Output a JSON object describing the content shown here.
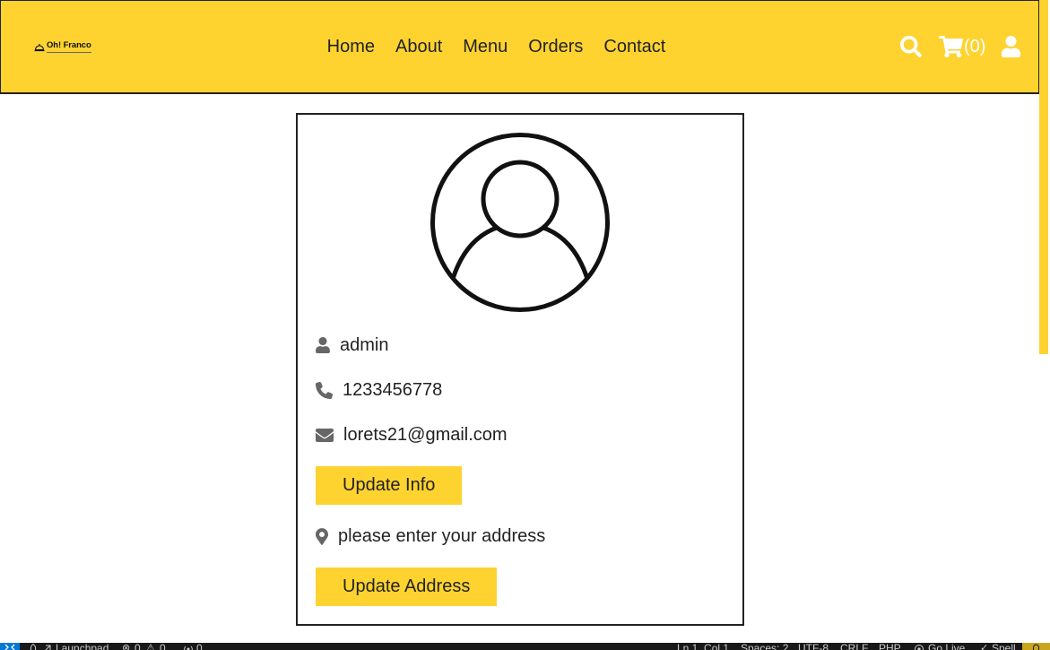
{
  "theme": {
    "accent": "#FED330",
    "text": "#222222",
    "icon_gray": "#666666",
    "header_icon": "#FFFFFF"
  },
  "header": {
    "logo": {
      "text": "Oh! Franco",
      "icon": "dish-logo-icon"
    },
    "nav": [
      {
        "label": "Home"
      },
      {
        "label": "About"
      },
      {
        "label": "Menu"
      },
      {
        "label": "Orders"
      },
      {
        "label": "Contact"
      }
    ],
    "icons": {
      "search": "search-icon",
      "cart": "cart-icon",
      "user": "user-icon"
    },
    "cart_count": "(0)"
  },
  "profile": {
    "avatar_icon": "user-circle-icon",
    "name": {
      "icon": "user-icon",
      "value": "admin"
    },
    "phone": {
      "icon": "phone-icon",
      "value": "1233456778"
    },
    "email": {
      "icon": "envelope-icon",
      "value": "lorets21@gmail.com"
    },
    "update_info_button": "Update Info",
    "address": {
      "icon": "map-marker-icon",
      "value": "please enter your address"
    },
    "update_address_button": "Update Address"
  },
  "status_bar": {
    "left": {
      "remote_icon": "remote-icon",
      "launchpad_icon": "rocket-icon",
      "launchpad": "Launchpad",
      "errors": "0",
      "warnings": "0",
      "ports": "0"
    },
    "right": {
      "position": "Ln 1, Col 1",
      "indentation": "Spaces: 2",
      "encoding": "UTF-8",
      "line_endings": "CRLF",
      "language": "PHP",
      "go_live": "Go Live",
      "spell": "Spell",
      "notifications_icon": "bell-icon"
    }
  }
}
